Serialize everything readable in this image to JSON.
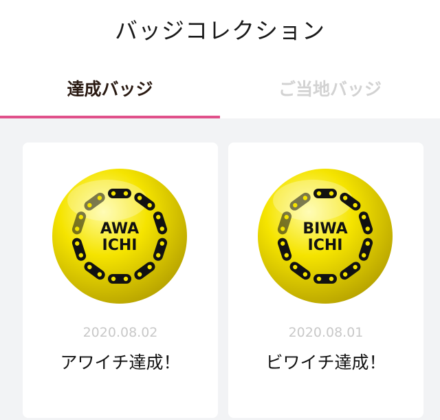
{
  "page": {
    "title": "バッジコレクション"
  },
  "tabs": [
    {
      "label": "達成バッジ",
      "active": true
    },
    {
      "label": "ご当地バッジ",
      "active": false
    }
  ],
  "colors": {
    "accent": "#e0508a",
    "badge_yellow": "#f5e400",
    "chain": "#111111"
  },
  "badges": [
    {
      "line1": "AWA",
      "line2": "ICHI",
      "date": "2020.08.02",
      "name": "アワイチ達成！",
      "icon": "bike-chain-badge"
    },
    {
      "line1": "BIWA",
      "line2": "ICHI",
      "date": "2020.08.01",
      "name": "ビワイチ達成！",
      "icon": "bike-chain-badge"
    }
  ]
}
